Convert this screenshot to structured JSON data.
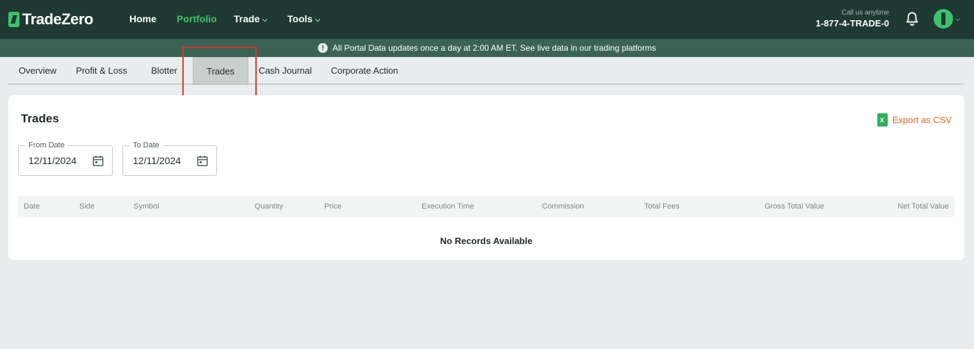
{
  "brand": {
    "name": "TradeZero"
  },
  "nav": {
    "home": "Home",
    "portfolio": "Portfolio",
    "trade": "Trade",
    "tools": "Tools"
  },
  "contact": {
    "label": "Call us anytime",
    "phone": "1-877-4-TRADE-0"
  },
  "banner": {
    "text": "All Portal Data updates once a day at 2:00 AM ET. See live data in our trading platforms"
  },
  "tabs": {
    "overview": "Overview",
    "profit_loss": "Profit & Loss",
    "blotter": "Blotter",
    "trades": "Trades",
    "cash_journal": "Cash Journal",
    "corporate_action": "Corporate Action",
    "active": "Trades"
  },
  "card": {
    "title": "Trades",
    "export_label": "Export as CSV",
    "from_date": {
      "label": "From Date",
      "value": "12/11/2024"
    },
    "to_date": {
      "label": "To Date",
      "value": "12/11/2024"
    },
    "columns": {
      "date": "Date",
      "side": "Side",
      "symbol": "Symbol",
      "quantity": "Quantity",
      "price": "Price",
      "execution_time": "Execution Time",
      "commission": "Commission",
      "total_fees": "Total Fees",
      "gross_total_value": "Gross Total Value",
      "net_total_value": "Net Total Value"
    },
    "empty_message": "No Records Available"
  },
  "colors": {
    "nav_bg": "#1f3a33",
    "banner_bg": "#3b6355",
    "accent_green": "#3ec26b",
    "export_orange": "#e2651a",
    "highlight_red": "#d9382a"
  },
  "icons": {
    "bell": "bell-icon",
    "avatar": "avatar-icon",
    "calendar": "calendar-icon",
    "excel": "excel-icon",
    "info": "exclamation-icon"
  }
}
